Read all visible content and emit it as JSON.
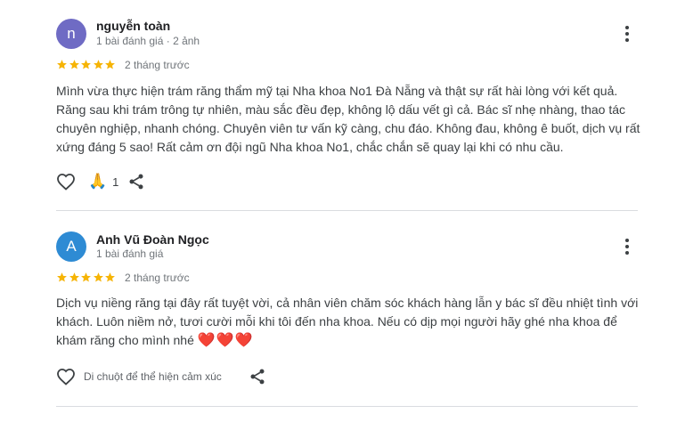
{
  "colors": {
    "avatar_1": "#6f6bc4",
    "avatar_2": "#2e8bd4",
    "star": "#f6b405",
    "heart_red": "#e11d2e",
    "divider": "#dadce0"
  },
  "reviews": [
    {
      "avatar_letter": "n",
      "author": "nguyễn toàn",
      "author_meta": "1 bài đánh giá · 2 ảnh",
      "rating": 5,
      "time": "2 tháng trước",
      "text": "Mình vừa thực hiện trám răng thẩm mỹ tại Nha khoa No1 Đà Nẵng và thật sự rất hài lòng với kết quả. Răng sau khi trám trông tự nhiên, màu sắc đều đẹp, không lộ dấu vết gì cả. Bác sĩ nhẹ nhàng, thao tác chuyên nghiệp, nhanh chóng. Chuyên viên tư vấn kỹ càng, chu đáo. Không đau, không ê buốt, dịch vụ rất xứng đáng 5 sao! Rất cảm ơn đội ngũ Nha khoa No1, chắc chắn sẽ quay lại khi có nhu cầu.",
      "reaction_emoji": "🙏",
      "reaction_count": "1"
    },
    {
      "avatar_letter": "A",
      "author": "Anh Vũ Đoàn Ngọc",
      "author_meta": "1 bài đánh giá",
      "rating": 5,
      "time": "2 tháng trước",
      "text": "Dịch vụ niềng răng tại đây rất tuyệt vời, cả nhân viên chăm sóc khách hàng lẫn y bác sĩ đều nhiệt tình với khách. Luôn niềm nở, tươi cười mỗi khi tôi đến nha khoa. Nếu có dịp mọi người hãy ghé nha khoa để khám răng cho mình nhé",
      "text_emoji": "❤️❤️❤️",
      "reaction_hint": "Di chuột để thể hiện cảm xúc"
    }
  ]
}
